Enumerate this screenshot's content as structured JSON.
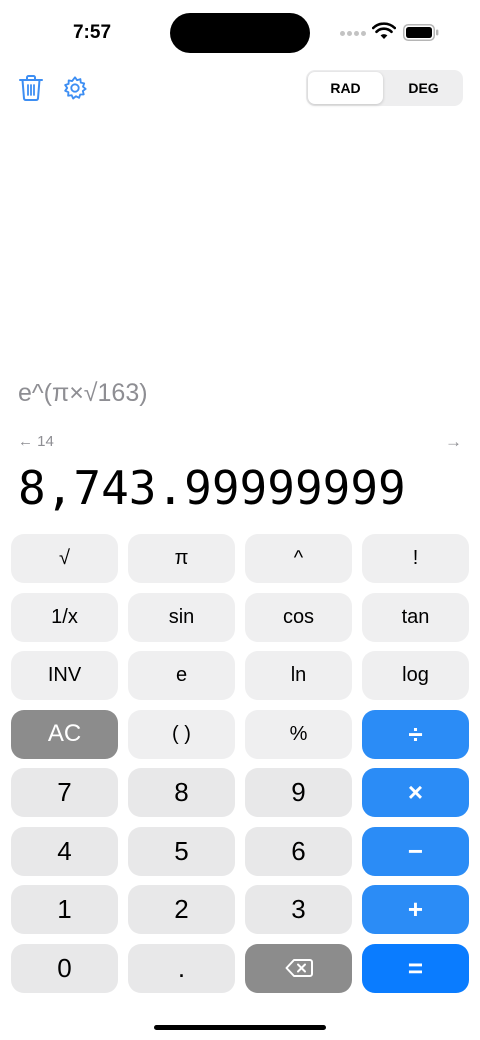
{
  "status_bar": {
    "time": "7:57"
  },
  "toolbar": {
    "trash_icon": "trash-icon",
    "settings_icon": "gear-icon",
    "angle_modes": [
      "RAD",
      "DEG"
    ],
    "selected_mode": "RAD"
  },
  "display": {
    "expression": "e^(π×√163)",
    "history_back_label": "← 14",
    "history_forward_label": "→",
    "result": "8,743.99999999"
  },
  "keypad": {
    "rows": [
      [
        "√",
        "π",
        "^",
        "!"
      ],
      [
        "1/x",
        "sin",
        "cos",
        "tan"
      ],
      [
        "INV",
        "e",
        "ln",
        "log"
      ],
      [
        "AC",
        "( )",
        "%",
        "÷"
      ],
      [
        "7",
        "8",
        "9",
        "×"
      ],
      [
        "4",
        "5",
        "6",
        "−"
      ],
      [
        "1",
        "2",
        "3",
        "+"
      ],
      [
        "0",
        ".",
        "backspace-icon",
        "="
      ]
    ]
  },
  "colors": {
    "accent": "#0a7cff",
    "operator": "#2b8cf6",
    "icon": "#3d8ef3",
    "clear_key": "#8c8c8c",
    "key_background": "#e8e8e9",
    "secondary_text": "#8e8e93"
  }
}
